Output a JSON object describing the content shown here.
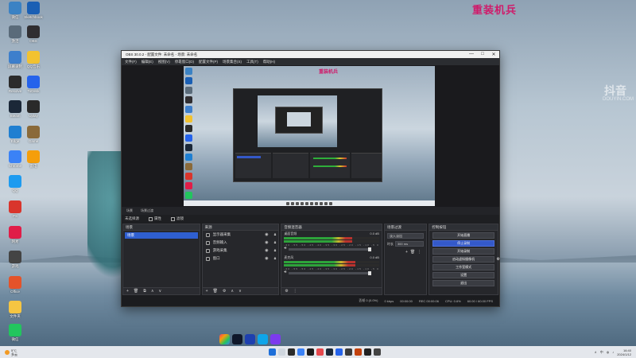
{
  "wallpaper": {
    "title": "重装机兵",
    "watermark": "抖音",
    "watermark_sub": "DOUYIN.COM"
  },
  "desktop_icons": [
    {
      "label": "微信",
      "color": "#3b82c4",
      "icon": "app-icon"
    },
    {
      "label": "Sketchbook",
      "color": "#1a5fb4",
      "icon": "app-icon"
    },
    {
      "label": "激活",
      "color": "#5a6b7a",
      "icon": "app-icon"
    },
    {
      "label": "OBS",
      "color": "#302e31",
      "icon": "obs-icon"
    },
    {
      "label": "屏幕录制",
      "color": "#3d7fcc",
      "icon": "app-icon"
    },
    {
      "label": "QQ音乐",
      "color": "#f2c230",
      "icon": "app-icon"
    },
    {
      "label": "Resolve",
      "color": "#2b2b2b",
      "icon": "app-icon"
    },
    {
      "label": "ToDesk",
      "color": "#2563eb",
      "icon": "app-icon"
    },
    {
      "label": "Steam",
      "color": "#1b2838",
      "icon": "steam-icon"
    },
    {
      "label": "Uplay",
      "color": "#2a2a2a",
      "icon": "app-icon"
    },
    {
      "label": "Edge",
      "color": "#1f7fd1",
      "icon": "edge-icon"
    },
    {
      "label": "Game",
      "color": "#8a6a3a",
      "icon": "app-icon"
    },
    {
      "label": "Chrome",
      "color": "#3b82f6",
      "icon": "app-icon"
    },
    {
      "label": "雷电",
      "color": "#f59e0b",
      "icon": "app-icon"
    },
    {
      "label": "QQ",
      "color": "#1d9bf0",
      "icon": "qq-icon"
    },
    {
      "label": "PS",
      "color": "#d9352c",
      "icon": "app-icon"
    },
    {
      "label": "网易",
      "color": "#e11d48",
      "icon": "app-icon"
    },
    {
      "label": "游戏",
      "color": "#444444",
      "icon": "app-icon"
    },
    {
      "label": "Office",
      "color": "#e4532a",
      "icon": "app-icon"
    },
    {
      "label": "文件夹",
      "color": "#f5c542",
      "icon": "folder-icon"
    },
    {
      "label": "微信",
      "color": "#22c55e",
      "icon": "wechat-icon"
    }
  ],
  "obs": {
    "title": "OBS 30.0.2 - 配置文件: 未命名 - 场景: 未命名",
    "window_controls": [
      "—",
      "□",
      "✕"
    ],
    "menu": [
      "文件(F)",
      "编辑(E)",
      "视图(V)",
      "停靠窗口(D)",
      "配置文件(P)",
      "场景集合(S)",
      "工具(T)",
      "帮助(H)"
    ],
    "preview_title": "重装机兵",
    "scene_tabs": [
      "场景",
      "场景过渡"
    ],
    "dock_toolbar": {
      "label": "未选择源",
      "properties": "属性",
      "filters": "滤镜"
    },
    "scenes": {
      "header": "场景",
      "items": [
        "场景"
      ],
      "footer": [
        "+",
        "🗑",
        "⧉",
        "∧",
        "∨"
      ]
    },
    "sources": {
      "header": "来源",
      "items": [
        {
          "name": "显示器采集",
          "visible": true,
          "locked": true
        },
        {
          "name": "音频输入",
          "visible": true,
          "locked": true
        },
        {
          "name": "游戏采集",
          "visible": true,
          "locked": true
        },
        {
          "name": "窗口",
          "visible": true,
          "locked": true
        }
      ],
      "footer": [
        "+",
        "🗑",
        "⚙",
        "∧",
        "∨"
      ]
    },
    "mixer": {
      "header": "音频混音器",
      "channels": [
        {
          "name": "桌面音频",
          "level_db": "0.0 dB",
          "level": 0.88,
          "fill": 0.72
        },
        {
          "name": "麦克风",
          "level_db": "0.0 dB",
          "level": 0.88,
          "fill": 0.75
        }
      ],
      "scale": "-60 -55 -50 -45 -40 -35 -30 -25 -20 -15 -10 -5 0"
    },
    "transitions": {
      "header": "场景过渡",
      "selected": "淡入淡出",
      "duration_label": "时长",
      "duration": "300 ms"
    },
    "controls": {
      "header": "控制按钮",
      "buttons": [
        {
          "label": "开始直播",
          "active": false
        },
        {
          "label": "停止录制",
          "active": true
        },
        {
          "label": "开始录制",
          "active": false
        },
        {
          "label": "启动虚拟摄像机",
          "active": false
        },
        {
          "label": "工作室模式",
          "active": false
        },
        {
          "label": "设置",
          "active": false
        },
        {
          "label": "退出",
          "active": false
        }
      ]
    },
    "status": {
      "frames": "丢帧 0 (0.0%)",
      "bitrate": "0 kbps",
      "time": "00:00:00",
      "rec": "REC 00:00:06",
      "cpu": "CPU: 0.6%",
      "fps": "60.00 / 60.00 FPS"
    }
  },
  "taskbar": {
    "weather_temp": "5°C",
    "weather_desc": "多云",
    "time": "16:40",
    "date": "2024/1/12",
    "lang": "中"
  }
}
